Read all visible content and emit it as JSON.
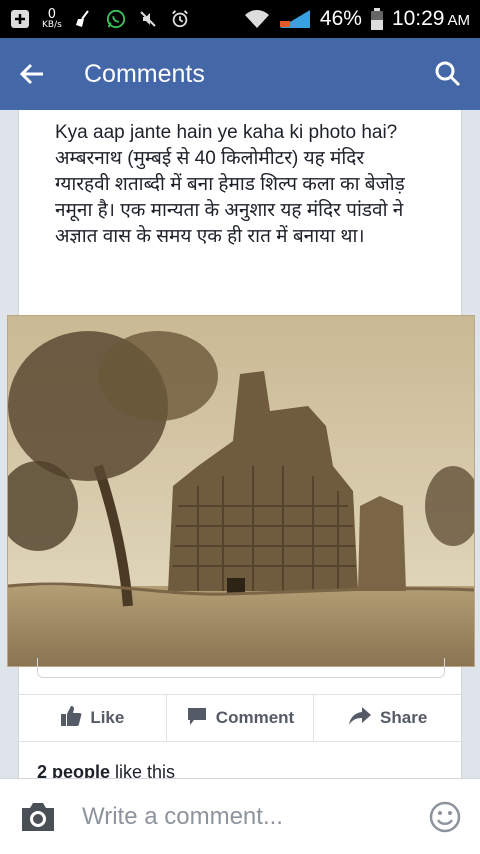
{
  "status_bar": {
    "net_speed_value": "0",
    "net_speed_unit": "KB/s",
    "battery": "46%",
    "time": "10:29",
    "ampm": "AM"
  },
  "app_bar": {
    "title": "Comments"
  },
  "post": {
    "line_en": "Kya aap jante hain ye kaha ki photo hai?",
    "line_hi": "अम्बरनाथ (मुम्बई से 40 किलोमीटर) यह मंदिर ग्यारहवी शताब्दी में बना हेमाड शिल्प कला का बेजोड़ नमूना है। एक मान्यता के अनुशार यह मंदिर पांडवो ने अज्ञात वास के समय एक ही रात में बनाया था।"
  },
  "actions": {
    "like": "Like",
    "comment": "Comment",
    "share": "Share"
  },
  "likes": {
    "count": "2 people",
    "suffix": " like this"
  },
  "composer": {
    "placeholder": "Write a comment..."
  },
  "colors": {
    "brand": "#4467a8",
    "status_bar": "#000000"
  }
}
